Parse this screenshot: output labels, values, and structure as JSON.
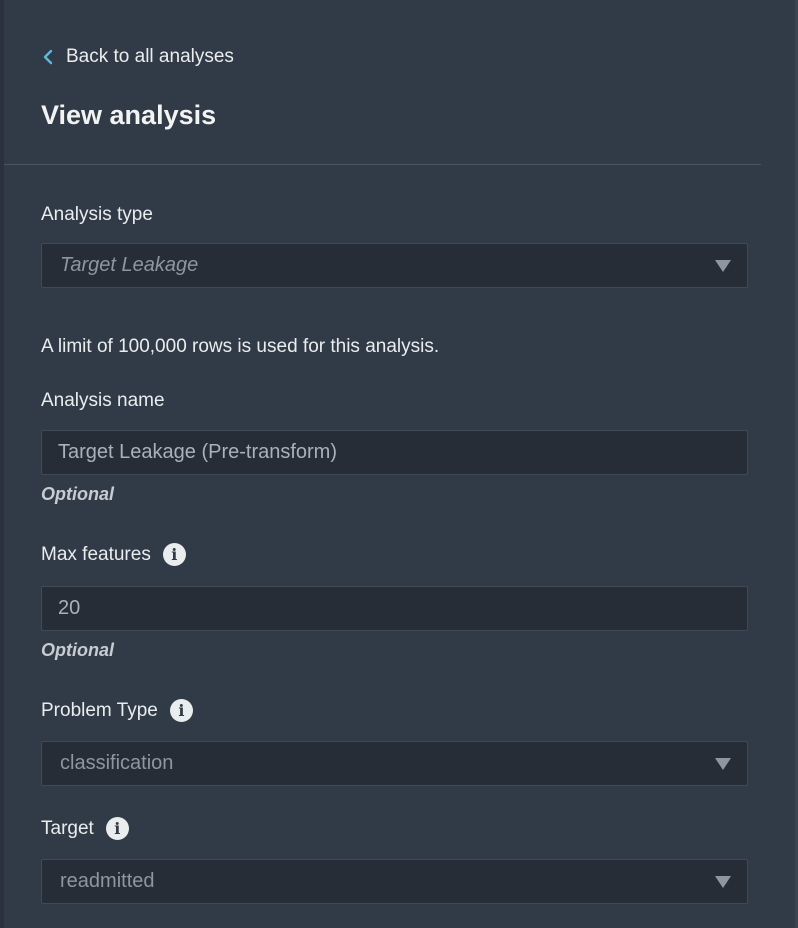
{
  "panel": {
    "back_label": "Back to all analyses",
    "title": "View analysis"
  },
  "analysis_type": {
    "label": "Analysis type",
    "value": "Target Leakage"
  },
  "notice": "A limit of 100,000 rows is used for this analysis.",
  "analysis_name": {
    "label": "Analysis name",
    "value": "Target Leakage (Pre-transform)",
    "hint": "Optional"
  },
  "max_features": {
    "label": "Max features",
    "value": "20",
    "hint": "Optional",
    "info_icon": "i"
  },
  "problem_type": {
    "label": "Problem Type",
    "value": "classification",
    "info_icon": "i"
  },
  "target": {
    "label": "Target",
    "value": "readmitted",
    "info_icon": "i"
  },
  "icons": {
    "back": "chevron-left-icon",
    "info": "info-icon",
    "dropdown": "caret-down-icon"
  },
  "colors": {
    "background": "#313a47",
    "field_background": "#262d37",
    "accent": "#5fb9d6",
    "text": "#eaeded"
  }
}
